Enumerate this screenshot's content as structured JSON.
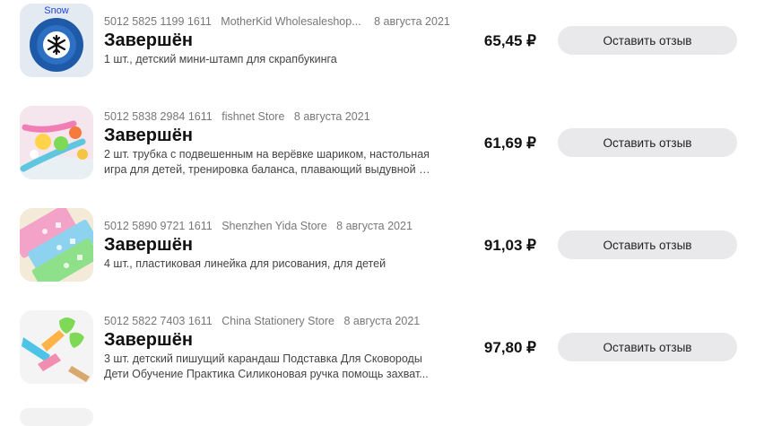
{
  "orders": [
    {
      "order_number": "5012 5825 1199 1611",
      "store": "MotherKid Wholesaleshop...",
      "date": "8 августа 2021",
      "status": "Завершён",
      "description_lines": [
        "1 шт., детский мини-штамп для скрапбукинга"
      ],
      "price": "65,45 ₽",
      "button_label": "Оставить отзыв",
      "thumb_text": "Snow",
      "thumb_icon": "snowflake-stamp-icon"
    },
    {
      "order_number": "5012 5838 2984 1611",
      "store": "fishnet Store",
      "date": "8 августа 2021",
      "status": "Завершён",
      "description_lines": [
        "2 шт. трубка с подвешенным на верёвке шариком, настольная",
        "игра для детей, тренировка баланса, плавающий выдувной ша..."
      ],
      "price": "61,69 ₽",
      "button_label": "Оставить отзыв",
      "thumb_icon": "blow-pipe-toy-image"
    },
    {
      "order_number": "5012 5890 9721 1611",
      "store": "Shenzhen Yida Store",
      "date": "8 августа 2021",
      "status": "Завершён",
      "description_lines": [
        "4 шт., пластиковая линейка для рисования, для детей"
      ],
      "price": "91,03 ₽",
      "button_label": "Оставить отзыв",
      "thumb_icon": "stencil-ruler-image"
    },
    {
      "order_number": "5012 5822 7403 1611",
      "store": "China Stationery Store",
      "date": "8 августа 2021",
      "status": "Завершён",
      "description_lines": [
        "3 шт. детский пишущий карандаш Подставка Для Сковороды",
        "Дети Обучение Практика Силиконовая ручка помощь захват..."
      ],
      "price": "97,80 ₽",
      "button_label": "Оставить отзыв",
      "thumb_icon": "pencil-grip-image"
    }
  ],
  "colors": {
    "button_bg": "#e9e9ec",
    "meta_text": "#777777",
    "snow_text": "#1e45d8"
  }
}
